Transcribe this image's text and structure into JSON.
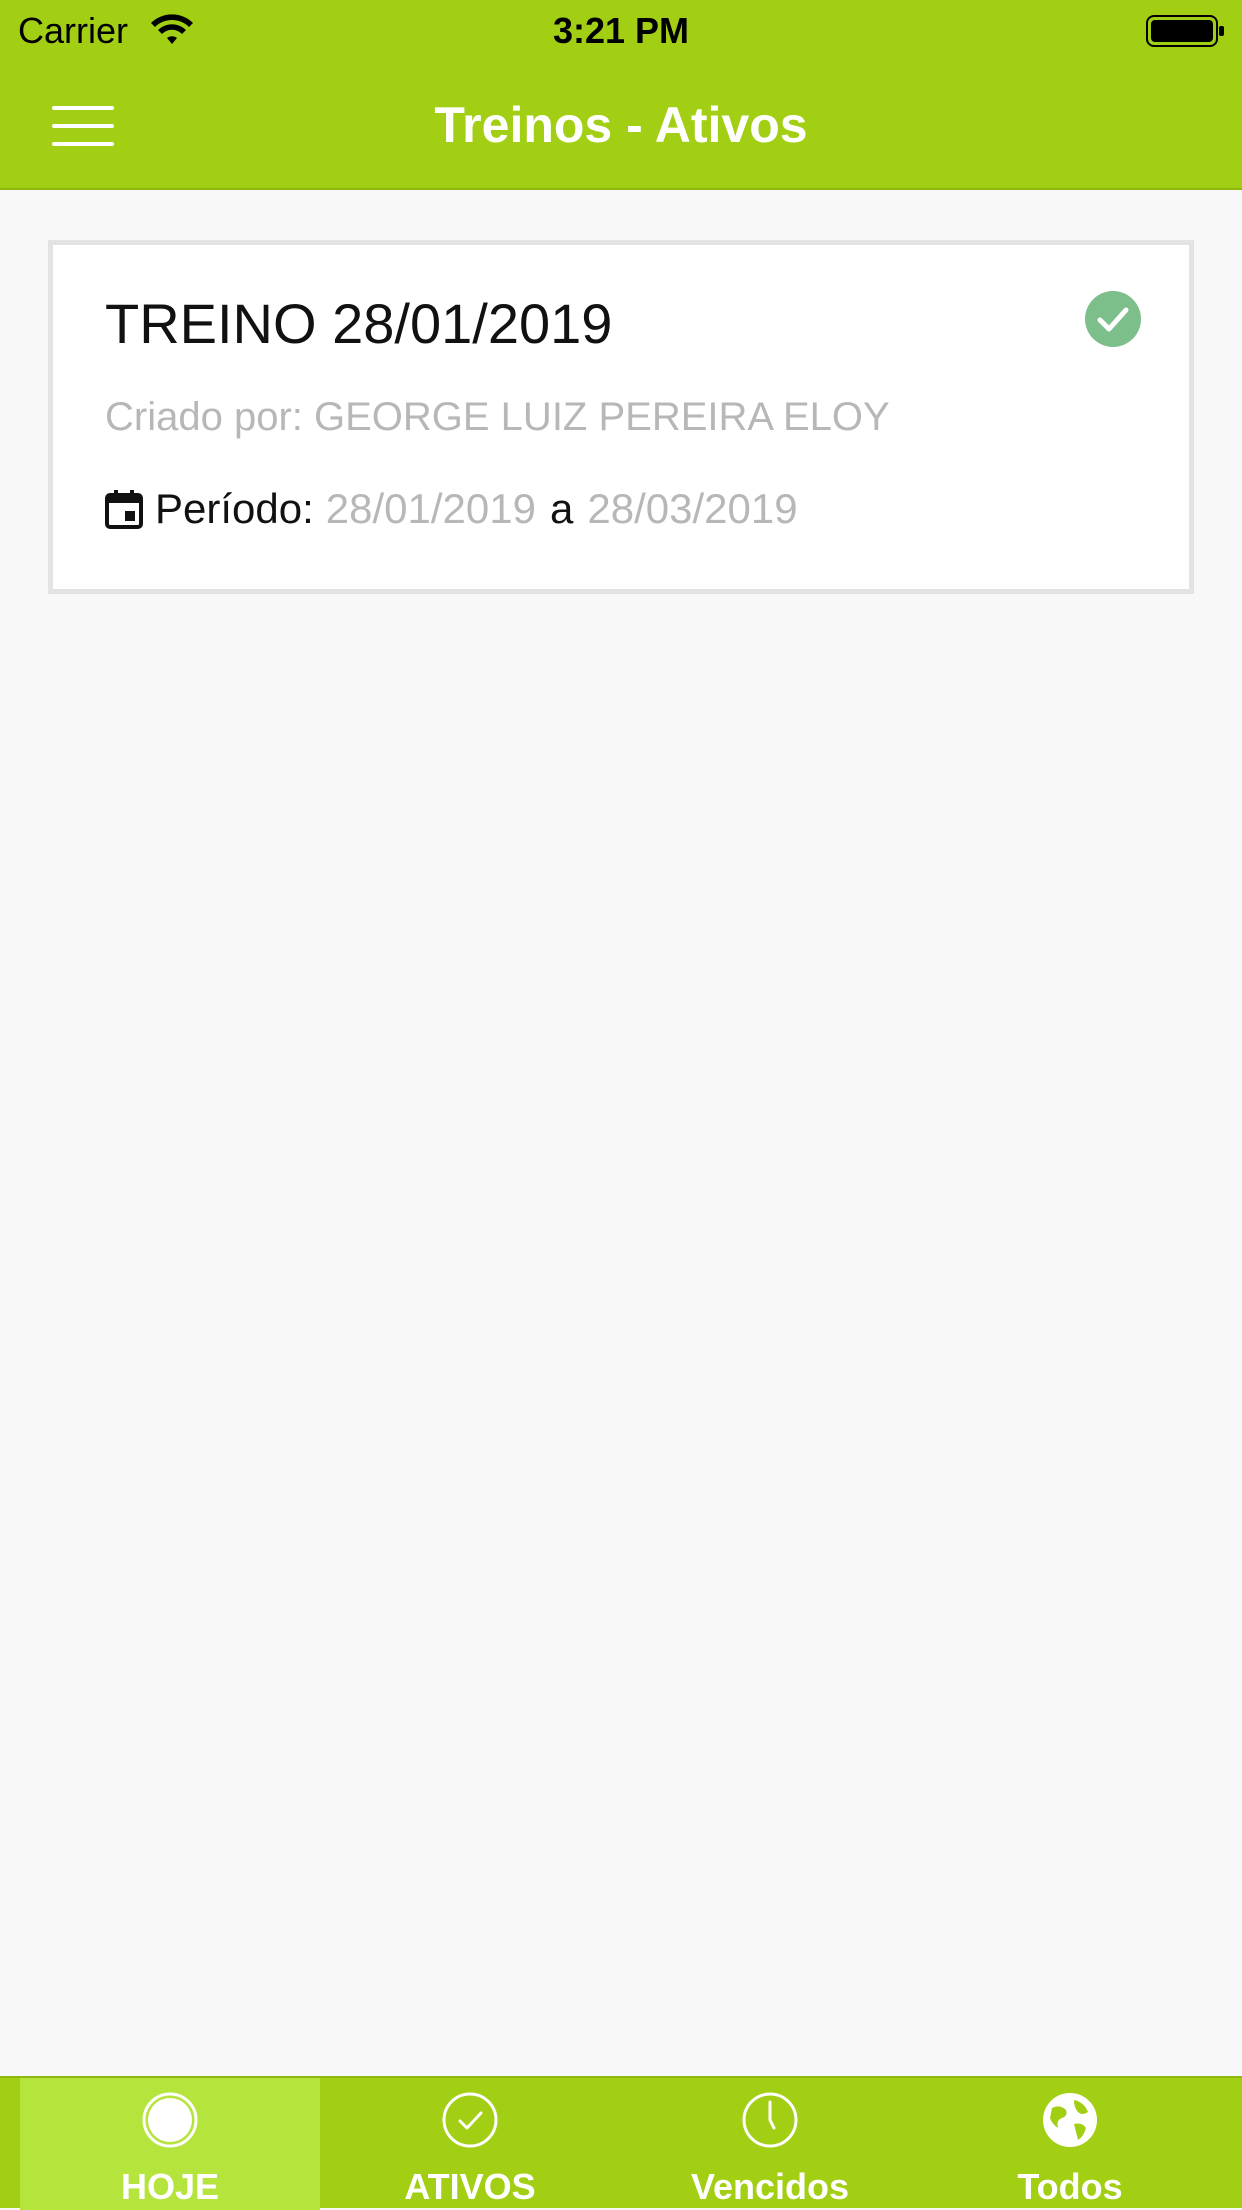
{
  "status_bar": {
    "carrier": "Carrier",
    "time": "3:21 PM"
  },
  "nav": {
    "title": "Treinos - Ativos",
    "menu_icon": "hamburger-icon"
  },
  "card": {
    "title": "TREINO 28/01/2019",
    "status_icon": "check-circle-icon",
    "status_color": "#7dbf8b",
    "created_by": "Criado por: GEORGE LUIZ PEREIRA ELOY",
    "period_label": "Período:",
    "period_start": "28/01/2019",
    "period_separator": "a",
    "period_end": "28/03/2019"
  },
  "tabs": [
    {
      "label": "HOJE",
      "icon": "circle-icon",
      "active": true
    },
    {
      "label": "ATIVOS",
      "icon": "check-circle-outline-icon",
      "active": false
    },
    {
      "label": "Vencidos",
      "icon": "clock-icon",
      "active": false
    },
    {
      "label": "Todos",
      "icon": "globe-icon",
      "active": false
    }
  ],
  "colors": {
    "accent": "#a2cf14",
    "tab_active": "#b5e43c",
    "muted_text": "#b7b7b7"
  }
}
